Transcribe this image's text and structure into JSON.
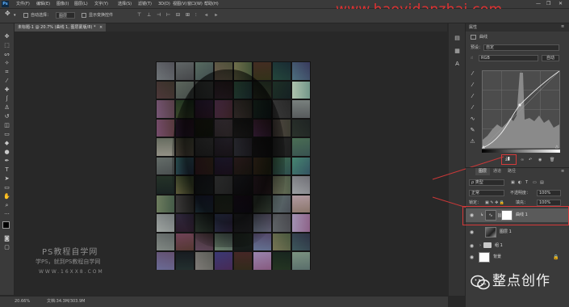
{
  "app": {
    "logo_text": "Ps",
    "window_controls": [
      "—",
      "❐",
      "✕"
    ]
  },
  "menu": [
    "文件(F)",
    "编辑(E)",
    "图像(I)",
    "图层(L)",
    "文字(Y)",
    "选择(S)",
    "滤镜(T)",
    "3D(D)",
    "视图(V)",
    "窗口(W)",
    "帮助(H)"
  ],
  "watermark_top": "www.haoyidanzhai.com",
  "options": {
    "auto_select_label": "自动选择：",
    "auto_select_value": "图层",
    "show_transform_label": "显示变换控件"
  },
  "document_tab": {
    "title": "未标题-1 @ 20.7% (曲线 1, 图层蒙版/8) *",
    "close": "×"
  },
  "status": {
    "zoom": "20.66%",
    "doc_info": "文档:34.3M/303.9M"
  },
  "canvas_watermark": {
    "title": "PS教程自学网",
    "subtitle": "学PS，就到PS教程自学网",
    "url": "WWW.16XX8.COM"
  },
  "properties": {
    "header": "属性",
    "panel_name": "曲线",
    "preset_label": "预设：",
    "preset_value": "自定",
    "channel_value": "RGB",
    "auto_label": "自动"
  },
  "layers": {
    "tabs": [
      "图层",
      "通道",
      "路径"
    ],
    "kind_label": "ρ 类型",
    "blend_mode": "正常",
    "opacity_label": "不透明度：",
    "opacity_value": "100%",
    "lock_label": "锁定：",
    "fill_label": "填充：",
    "fill_value": "100%",
    "rows": [
      {
        "name": "曲线 1",
        "selected": true
      },
      {
        "name": "图层 1",
        "selected": false
      },
      {
        "name": "组 1",
        "selected": false
      },
      {
        "name": "背景",
        "selected": false
      }
    ]
  },
  "brand": {
    "name": "整点创作"
  },
  "colors": {
    "accent": "#e13131",
    "highlight_box": "#d43a3a",
    "arrow": "#c93838"
  }
}
